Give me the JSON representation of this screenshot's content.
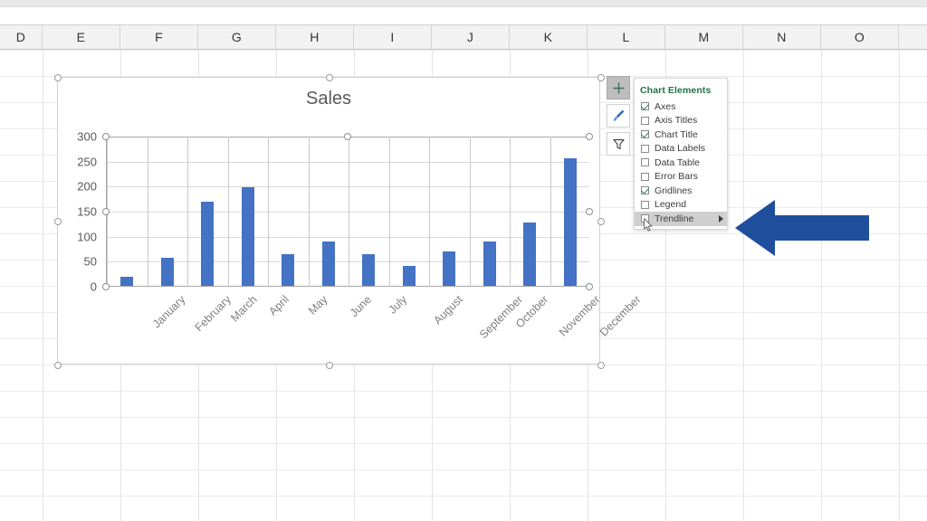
{
  "app": {
    "name": "spreadsheet-chart-editor"
  },
  "spreadsheet": {
    "column_headers": [
      "D",
      "E",
      "F",
      "G",
      "H",
      "I",
      "J",
      "K",
      "L",
      "M",
      "N",
      "O"
    ]
  },
  "chart": {
    "title": "Sales",
    "series_color": "#4472c4",
    "selected": true
  },
  "chart_data": {
    "type": "bar",
    "title": "Sales",
    "xlabel": "",
    "ylabel": "",
    "ylim": [
      0,
      300
    ],
    "yticks": [
      0,
      50,
      100,
      150,
      200,
      250,
      300
    ],
    "grid": true,
    "legend": false,
    "legend_position": "none",
    "categories": [
      "January",
      "February",
      "March",
      "April",
      "May",
      "June",
      "July",
      "August",
      "September",
      "October",
      "November",
      "December"
    ],
    "values": [
      19,
      56,
      168,
      197,
      63,
      88,
      63,
      40,
      68,
      88,
      126,
      254
    ]
  },
  "chart_buttons": [
    {
      "name": "chart-elements-button",
      "icon": "plus-icon",
      "active": true
    },
    {
      "name": "chart-styles-button",
      "icon": "paintbrush-icon",
      "active": false
    },
    {
      "name": "chart-filters-button",
      "icon": "funnel-icon",
      "active": false
    }
  ],
  "chart_elements_panel": {
    "title": "Chart Elements",
    "items": [
      {
        "label": "Axes",
        "checked": true,
        "highlighted": false,
        "submenu": false
      },
      {
        "label": "Axis Titles",
        "checked": false,
        "highlighted": false,
        "submenu": false
      },
      {
        "label": "Chart Title",
        "checked": true,
        "highlighted": false,
        "submenu": false
      },
      {
        "label": "Data Labels",
        "checked": false,
        "highlighted": false,
        "submenu": false
      },
      {
        "label": "Data Table",
        "checked": false,
        "highlighted": false,
        "submenu": false
      },
      {
        "label": "Error Bars",
        "checked": false,
        "highlighted": false,
        "submenu": false
      },
      {
        "label": "Gridlines",
        "checked": true,
        "highlighted": false,
        "submenu": false
      },
      {
        "label": "Legend",
        "checked": false,
        "highlighted": false,
        "submenu": false
      },
      {
        "label": "Trendline",
        "checked": false,
        "highlighted": true,
        "submenu": true
      }
    ]
  },
  "annotation": {
    "arrow_direction": "left",
    "arrow_color": "#1f4e9c"
  }
}
